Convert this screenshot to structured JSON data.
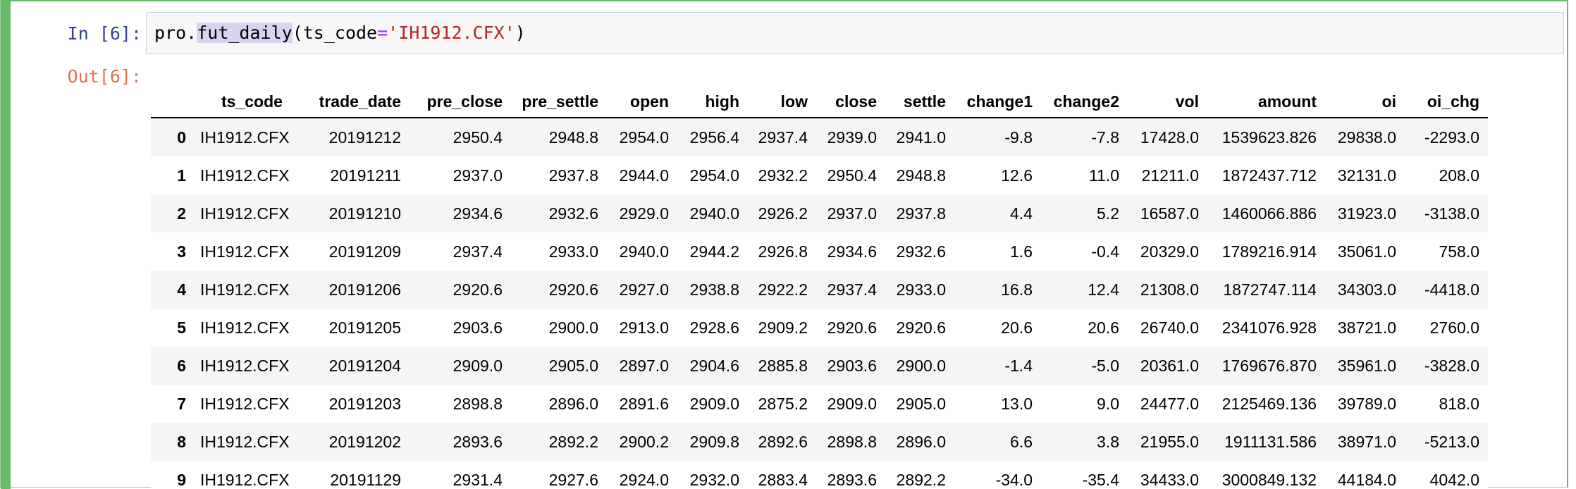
{
  "notebook": {
    "in_prompt": "In [6]:",
    "out_prompt": "Out[6]:",
    "code": {
      "obj": "pro.",
      "method": "fut_daily",
      "open_paren": "(",
      "arg_name": "ts_code",
      "op": "=",
      "arg_value": "'IH1912.CFX'",
      "close_paren": ")"
    }
  },
  "dataframe": {
    "columns": [
      "ts_code",
      "trade_date",
      "pre_close",
      "pre_settle",
      "open",
      "high",
      "low",
      "close",
      "settle",
      "change1",
      "change2",
      "vol",
      "amount",
      "oi",
      "oi_chg"
    ],
    "rows": [
      {
        "index": "0",
        "cells": [
          "IH1912.CFX",
          "20191212",
          "2950.4",
          "2948.8",
          "2954.0",
          "2956.4",
          "2937.4",
          "2939.0",
          "2941.0",
          "-9.8",
          "-7.8",
          "17428.0",
          "1539623.826",
          "29838.0",
          "-2293.0"
        ]
      },
      {
        "index": "1",
        "cells": [
          "IH1912.CFX",
          "20191211",
          "2937.0",
          "2937.8",
          "2944.0",
          "2954.0",
          "2932.2",
          "2950.4",
          "2948.8",
          "12.6",
          "11.0",
          "21211.0",
          "1872437.712",
          "32131.0",
          "208.0"
        ]
      },
      {
        "index": "2",
        "cells": [
          "IH1912.CFX",
          "20191210",
          "2934.6",
          "2932.6",
          "2929.0",
          "2940.0",
          "2926.2",
          "2937.0",
          "2937.8",
          "4.4",
          "5.2",
          "16587.0",
          "1460066.886",
          "31923.0",
          "-3138.0"
        ]
      },
      {
        "index": "3",
        "cells": [
          "IH1912.CFX",
          "20191209",
          "2937.4",
          "2933.0",
          "2940.0",
          "2944.2",
          "2926.8",
          "2934.6",
          "2932.6",
          "1.6",
          "-0.4",
          "20329.0",
          "1789216.914",
          "35061.0",
          "758.0"
        ]
      },
      {
        "index": "4",
        "cells": [
          "IH1912.CFX",
          "20191206",
          "2920.6",
          "2920.6",
          "2927.0",
          "2938.8",
          "2922.2",
          "2937.4",
          "2933.0",
          "16.8",
          "12.4",
          "21308.0",
          "1872747.114",
          "34303.0",
          "-4418.0"
        ]
      },
      {
        "index": "5",
        "cells": [
          "IH1912.CFX",
          "20191205",
          "2903.6",
          "2900.0",
          "2913.0",
          "2928.6",
          "2909.2",
          "2920.6",
          "2920.6",
          "20.6",
          "20.6",
          "26740.0",
          "2341076.928",
          "38721.0",
          "2760.0"
        ]
      },
      {
        "index": "6",
        "cells": [
          "IH1912.CFX",
          "20191204",
          "2909.0",
          "2905.0",
          "2897.0",
          "2904.6",
          "2885.8",
          "2903.6",
          "2900.0",
          "-1.4",
          "-5.0",
          "20361.0",
          "1769676.870",
          "35961.0",
          "-3828.0"
        ]
      },
      {
        "index": "7",
        "cells": [
          "IH1912.CFX",
          "20191203",
          "2898.8",
          "2896.0",
          "2891.6",
          "2909.0",
          "2875.2",
          "2909.0",
          "2905.0",
          "13.0",
          "9.0",
          "24477.0",
          "2125469.136",
          "39789.0",
          "818.0"
        ]
      },
      {
        "index": "8",
        "cells": [
          "IH1912.CFX",
          "20191202",
          "2893.6",
          "2892.2",
          "2900.2",
          "2909.8",
          "2892.6",
          "2898.8",
          "2896.0",
          "6.6",
          "3.8",
          "21955.0",
          "1911131.586",
          "38971.0",
          "-5213.0"
        ]
      },
      {
        "index": "9",
        "cells": [
          "IH1912.CFX",
          "20191129",
          "2931.4",
          "2927.6",
          "2924.0",
          "2932.0",
          "2883.4",
          "2893.6",
          "2892.2",
          "-34.0",
          "-35.4",
          "34433.0",
          "3000849.132",
          "44184.0",
          "4042.0"
        ]
      }
    ]
  }
}
